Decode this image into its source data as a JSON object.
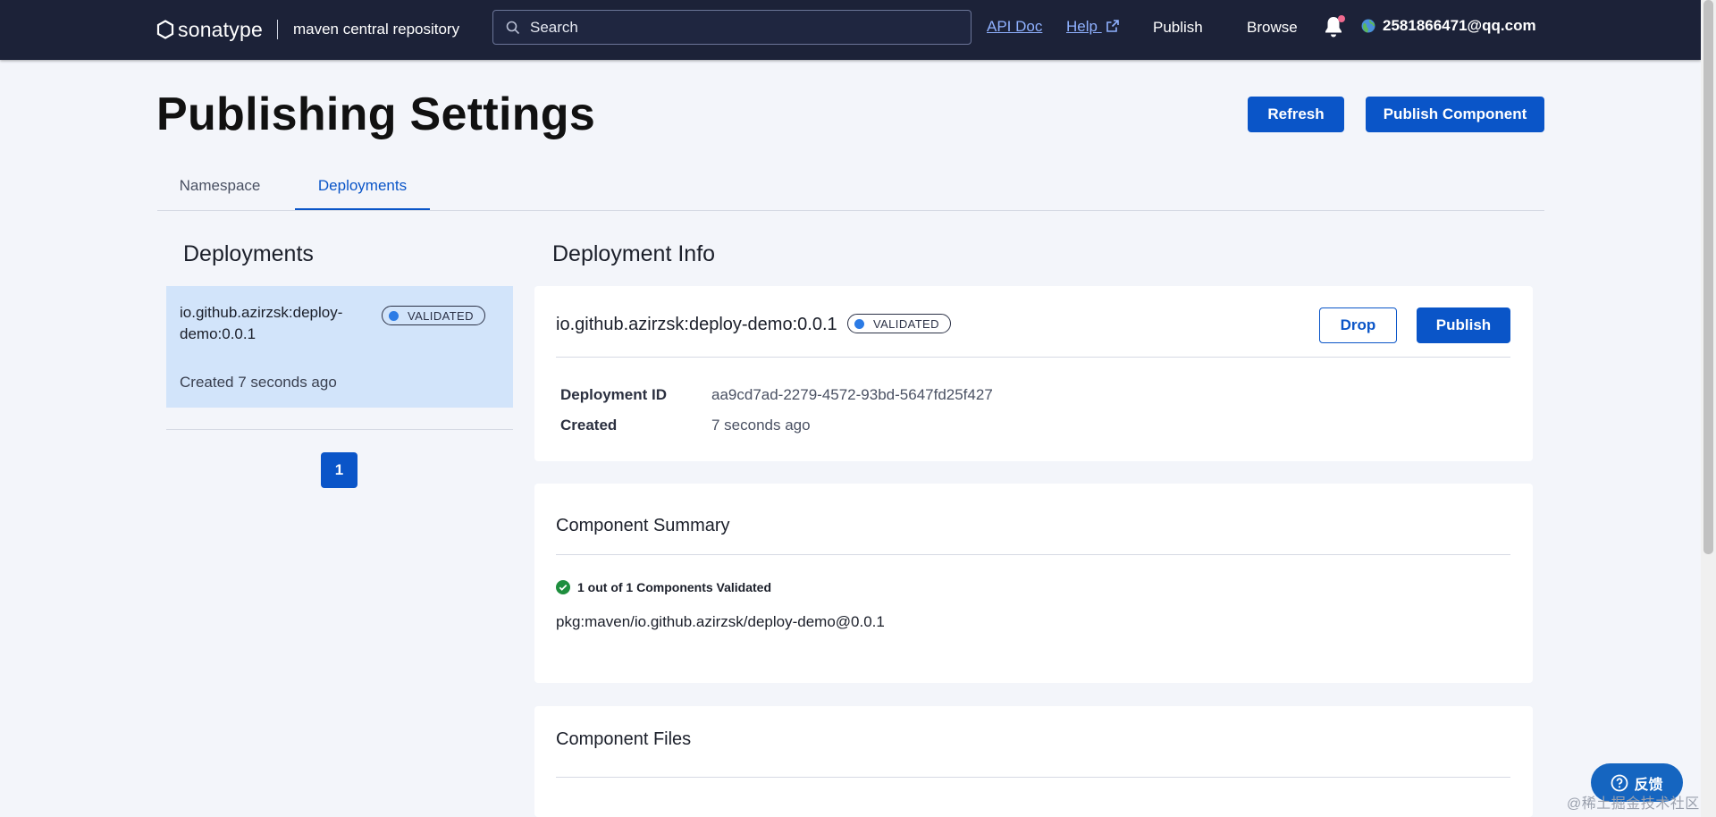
{
  "header": {
    "brand": "sonatype",
    "subtitle": "maven central repository",
    "search_placeholder": "Search",
    "api_doc": "API Doc",
    "help": "Help",
    "publish": "Publish",
    "browse": "Browse",
    "user": "2581866471@qq.com"
  },
  "page": {
    "title": "Publishing Settings",
    "refresh": "Refresh",
    "publish_component": "Publish Component"
  },
  "tabs": [
    {
      "label": "Namespace"
    },
    {
      "label": "Deployments"
    }
  ],
  "deployments": {
    "title": "Deployments",
    "items": [
      {
        "name": "io.github.azirzsk:deploy-demo:0.0.1",
        "status": "VALIDATED",
        "created": "Created 7 seconds ago"
      }
    ],
    "pagination": {
      "current": "1"
    }
  },
  "info": {
    "title": "Deployment Info",
    "name": "io.github.azirzsk:deploy-demo:0.0.1",
    "status": "VALIDATED",
    "drop": "Drop",
    "publish": "Publish",
    "deployment_id_label": "Deployment ID",
    "deployment_id": "aa9cd7ad-2279-4572-93bd-5647fd25f427",
    "created_label": "Created",
    "created": "7 seconds ago"
  },
  "summary": {
    "title": "Component Summary",
    "validated": "1 out of 1 Components Validated",
    "purl": "pkg:maven/io.github.azirzsk/deploy-demo@0.0.1"
  },
  "files": {
    "title": "Component Files"
  },
  "widget": {
    "feedback": "反馈",
    "watermark": "@稀土掘金技术社区"
  },
  "colors": {
    "nav_bg": "#1c2238",
    "primary": "#0a55c8",
    "selected_card": "#d2e4fa",
    "page_bg": "#f3f5fa",
    "success": "#1e8e3e"
  }
}
